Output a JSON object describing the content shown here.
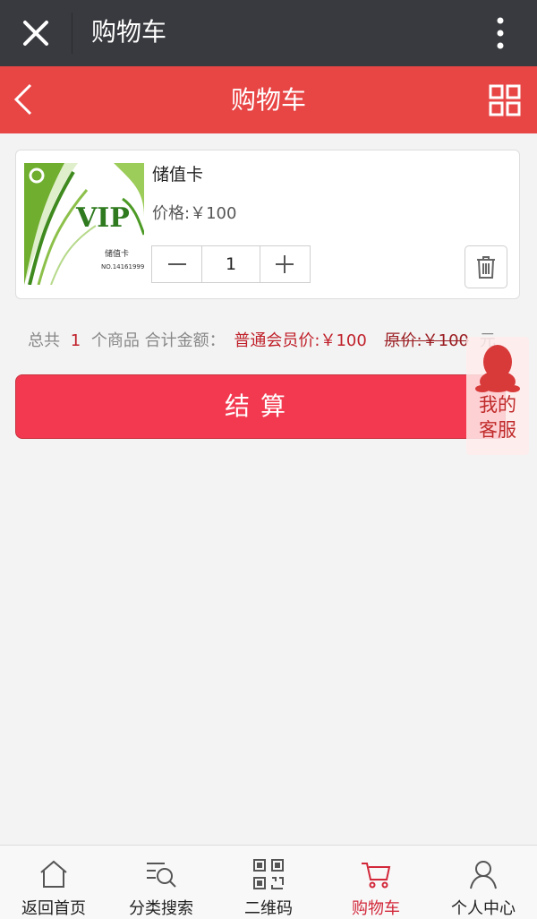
{
  "topbar": {
    "title": "购物车"
  },
  "header": {
    "title": "购物车"
  },
  "cart": {
    "items": [
      {
        "name": "储值卡",
        "price_label": "价格:￥100",
        "quantity": "1",
        "thumb": {
          "brand": "VIP",
          "caption": "储值卡",
          "serial": "NO.14161999"
        }
      }
    ]
  },
  "summary": {
    "prefix": "总共",
    "count": "1",
    "middle": "个商品 合计金额：",
    "member_price": "普通会员价:￥100",
    "original_price": "原价:￥100",
    "unit": "元"
  },
  "checkout": {
    "label": "结算"
  },
  "service": {
    "line1": "我的",
    "line2": "客服"
  },
  "tabs": [
    {
      "label": "返回首页",
      "icon": "home-icon"
    },
    {
      "label": "分类搜索",
      "icon": "category-search-icon"
    },
    {
      "label": "二维码",
      "icon": "qrcode-icon"
    },
    {
      "label": "购物车",
      "icon": "cart-icon",
      "active": true
    },
    {
      "label": "个人中心",
      "icon": "user-icon"
    }
  ],
  "colors": {
    "header": "#e84545",
    "checkout": "#f23950",
    "topbar": "#393a3f",
    "active_tab": "#d2283a"
  }
}
